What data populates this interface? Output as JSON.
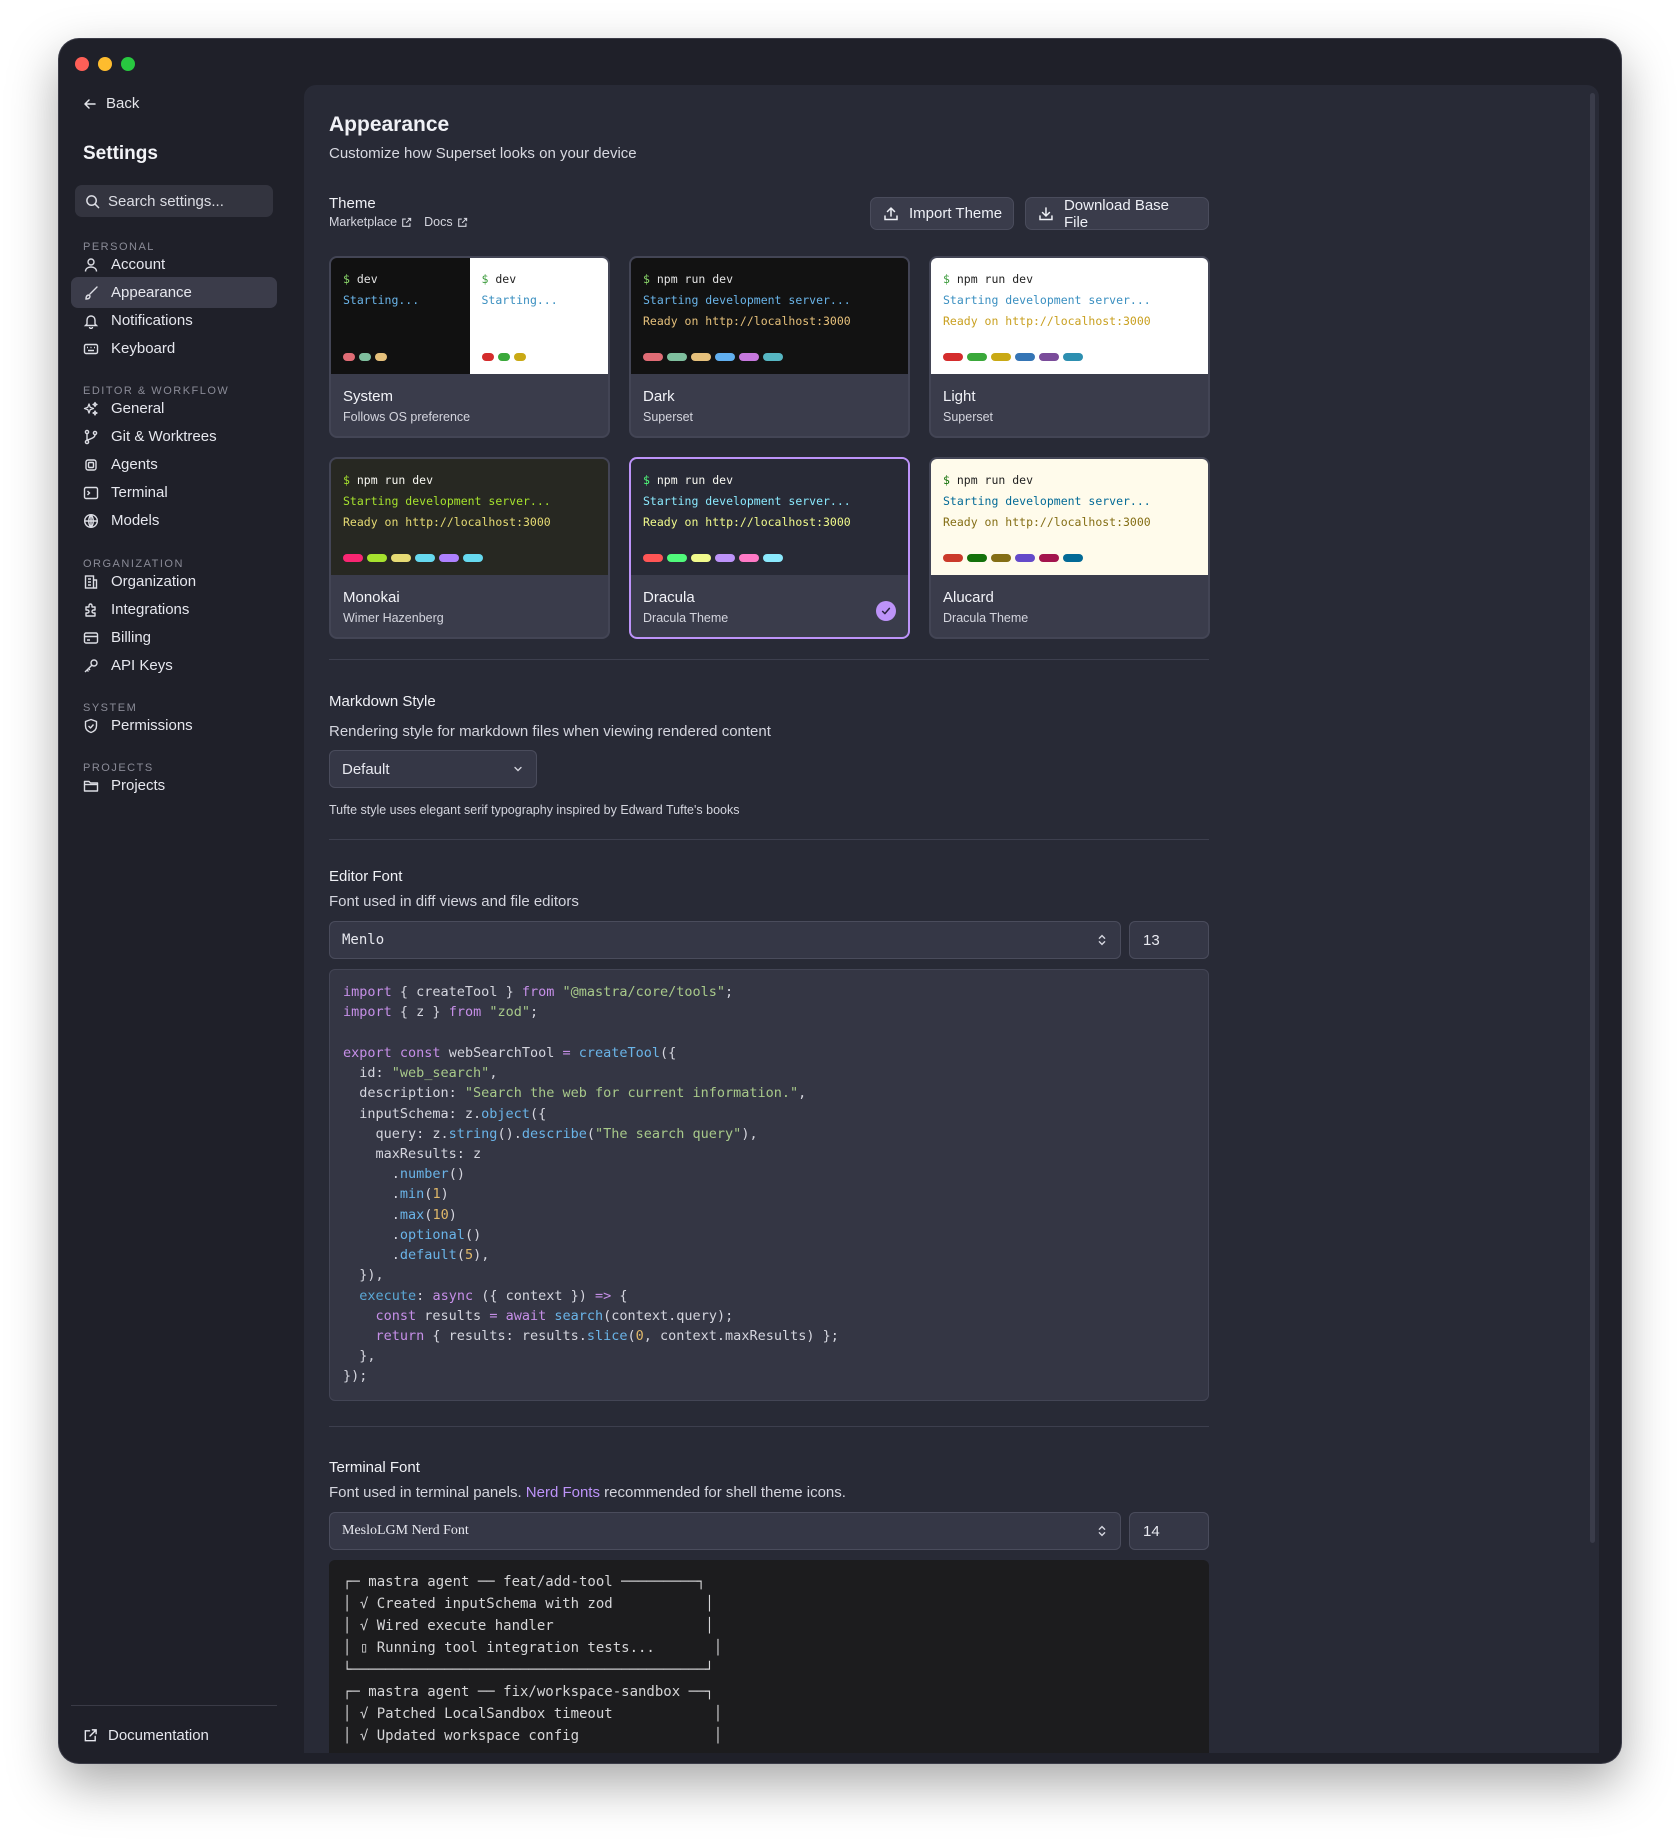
{
  "sidebar": {
    "back_label": "Back",
    "title": "Settings",
    "search_placeholder": "Search settings...",
    "groups": [
      {
        "label": "PERSONAL",
        "items": [
          "Account",
          "Appearance",
          "Notifications",
          "Keyboard"
        ]
      },
      {
        "label": "EDITOR & WORKFLOW",
        "items": [
          "General",
          "Git & Worktrees",
          "Agents",
          "Terminal",
          "Models"
        ]
      },
      {
        "label": "ORGANIZATION",
        "items": [
          "Organization",
          "Integrations",
          "Billing",
          "API Keys"
        ]
      },
      {
        "label": "SYSTEM",
        "items": [
          "Permissions"
        ]
      },
      {
        "label": "PROJECTS",
        "items": [
          "Projects"
        ]
      }
    ],
    "active_item": "Appearance",
    "documentation_label": "Documentation"
  },
  "page": {
    "title": "Appearance",
    "subtitle": "Customize how Superset looks on your device"
  },
  "theme": {
    "title": "Theme",
    "marketplace_label": "Marketplace",
    "docs_label": "Docs",
    "import_label": "Import Theme",
    "download_label": "Download Base File",
    "cards": [
      {
        "name": "System",
        "sub": "Follows OS preference",
        "selected": false,
        "left_line1": "$ dev",
        "left_line2": "Starting...",
        "right_line1": "$ dev",
        "right_line2": "Starting..."
      },
      {
        "name": "Dark",
        "sub": "Superset",
        "selected": false,
        "line1": "$ npm run dev",
        "line2": "Starting development server...",
        "line3": "Ready on http://localhost:3000"
      },
      {
        "name": "Light",
        "sub": "Superset",
        "selected": false,
        "line1": "$ npm run dev",
        "line2": "Starting development server...",
        "line3": "Ready on http://localhost:3000"
      },
      {
        "name": "Monokai",
        "sub": "Wimer Hazenberg",
        "selected": false,
        "line1": "$ npm run dev",
        "line2": "Starting development server...",
        "line3": "Ready on http://localhost:3000"
      },
      {
        "name": "Dracula",
        "sub": "Dracula Theme",
        "selected": true,
        "line1": "$ npm run dev",
        "line2": "Starting development server...",
        "line3": "Ready on http://localhost:3000"
      },
      {
        "name": "Alucard",
        "sub": "Dracula Theme",
        "selected": false,
        "line1": "$ npm run dev",
        "line2": "Starting development server...",
        "line3": "Ready on http://localhost:3000"
      }
    ]
  },
  "markdown": {
    "title": "Markdown Style",
    "description": "Rendering style for markdown files when viewing rendered content",
    "selected": "Default",
    "hint": "Tufte style uses elegant serif typography inspired by Edward Tufte's books"
  },
  "editor_font": {
    "title": "Editor Font",
    "description": "Font used in diff views and file editors",
    "font": "Menlo",
    "size": "13"
  },
  "terminal_font": {
    "title": "Terminal Font",
    "description_before": "Font used in terminal panels.",
    "link": "Nerd Fonts",
    "description_after": "recommended for shell theme icons.",
    "font": "MesloLGM Nerd Font",
    "size": "14",
    "preview_lines": [
      "┌─ mastra agent ── feat/add-tool ─────────┐",
      "│ √ Created inputSchema with zod           │",
      "│ √ Wired execute handler                  │",
      "│ ▯ Running tool integration tests...       │",
      "└──────────────────────────────────────────┘",
      "",
      "┌─ mastra agent ── fix/workspace-sandbox ──┐",
      "│ √ Patched LocalSandbox timeout            │",
      "│ √ Updated workspace config                │"
    ]
  },
  "colors": {
    "accent": "#bd93f9",
    "link": "#bd93f9",
    "window_bg": "#1f2029",
    "main_bg": "#282a36"
  }
}
